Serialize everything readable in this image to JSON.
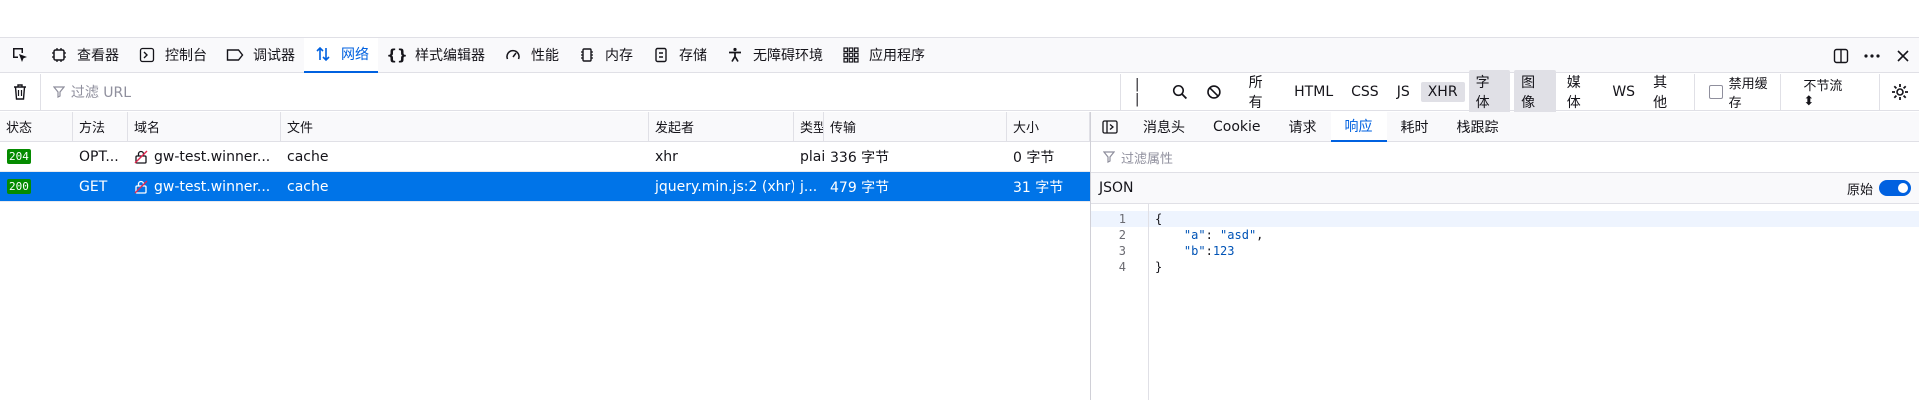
{
  "toolbar": {
    "tabs": [
      {
        "label": "查看器",
        "icon": "inspector-icon"
      },
      {
        "label": "控制台",
        "icon": "console-icon"
      },
      {
        "label": "调试器",
        "icon": "debugger-icon"
      },
      {
        "label": "网络",
        "icon": "network-icon",
        "active": true
      },
      {
        "label": "样式编辑器",
        "icon": "style-editor-icon"
      },
      {
        "label": "性能",
        "icon": "performance-icon"
      },
      {
        "label": "内存",
        "icon": "memory-icon"
      },
      {
        "label": "存储",
        "icon": "storage-icon"
      },
      {
        "label": "无障碍环境",
        "icon": "accessibility-icon"
      },
      {
        "label": "应用程序",
        "icon": "application-icon"
      }
    ]
  },
  "filterbar": {
    "url_placeholder": "过滤 URL",
    "types": [
      "所有",
      "HTML",
      "CSS",
      "JS",
      "XHR",
      "字体",
      "图像",
      "媒体",
      "WS",
      "其他"
    ],
    "selected_types": [
      "XHR",
      "字体",
      "图像"
    ],
    "disable_cache_label": "禁用缓存",
    "throttle_label": "不节流 ⬍"
  },
  "table": {
    "headers": [
      "状态",
      "方法",
      "域名",
      "文件",
      "发起者",
      "类型",
      "传输",
      "大小"
    ],
    "rows": [
      {
        "status": "204",
        "method": "OPT...",
        "domain": "gw-test.winner...",
        "file": "cache",
        "initiator": "xhr",
        "type": "plai",
        "transferred": "336 字节",
        "size": "0 字节"
      },
      {
        "status": "200",
        "method": "GET",
        "domain": "gw-test.winner...",
        "file": "cache",
        "initiator": "jquery.min.js:2 (xhr)",
        "type": "j...",
        "transferred": "479 字节",
        "size": "31 字节"
      }
    ]
  },
  "details": {
    "tabs": [
      "消息头",
      "Cookie",
      "请求",
      "响应",
      "耗时",
      "栈跟踪"
    ],
    "active_tab": "响应",
    "filter_placeholder": "过滤属性",
    "json_label": "JSON",
    "raw_label": "原始",
    "code_lines": [
      {
        "n": "1",
        "text": "{"
      },
      {
        "n": "2",
        "text": "    \"a\": \"asd\","
      },
      {
        "n": "3",
        "text": "    \"b\":123"
      },
      {
        "n": "4",
        "text": "}"
      }
    ]
  },
  "colors": {
    "accent": "#0061e0",
    "selected_row": "#0074e8",
    "status_ok": "#058b00"
  }
}
